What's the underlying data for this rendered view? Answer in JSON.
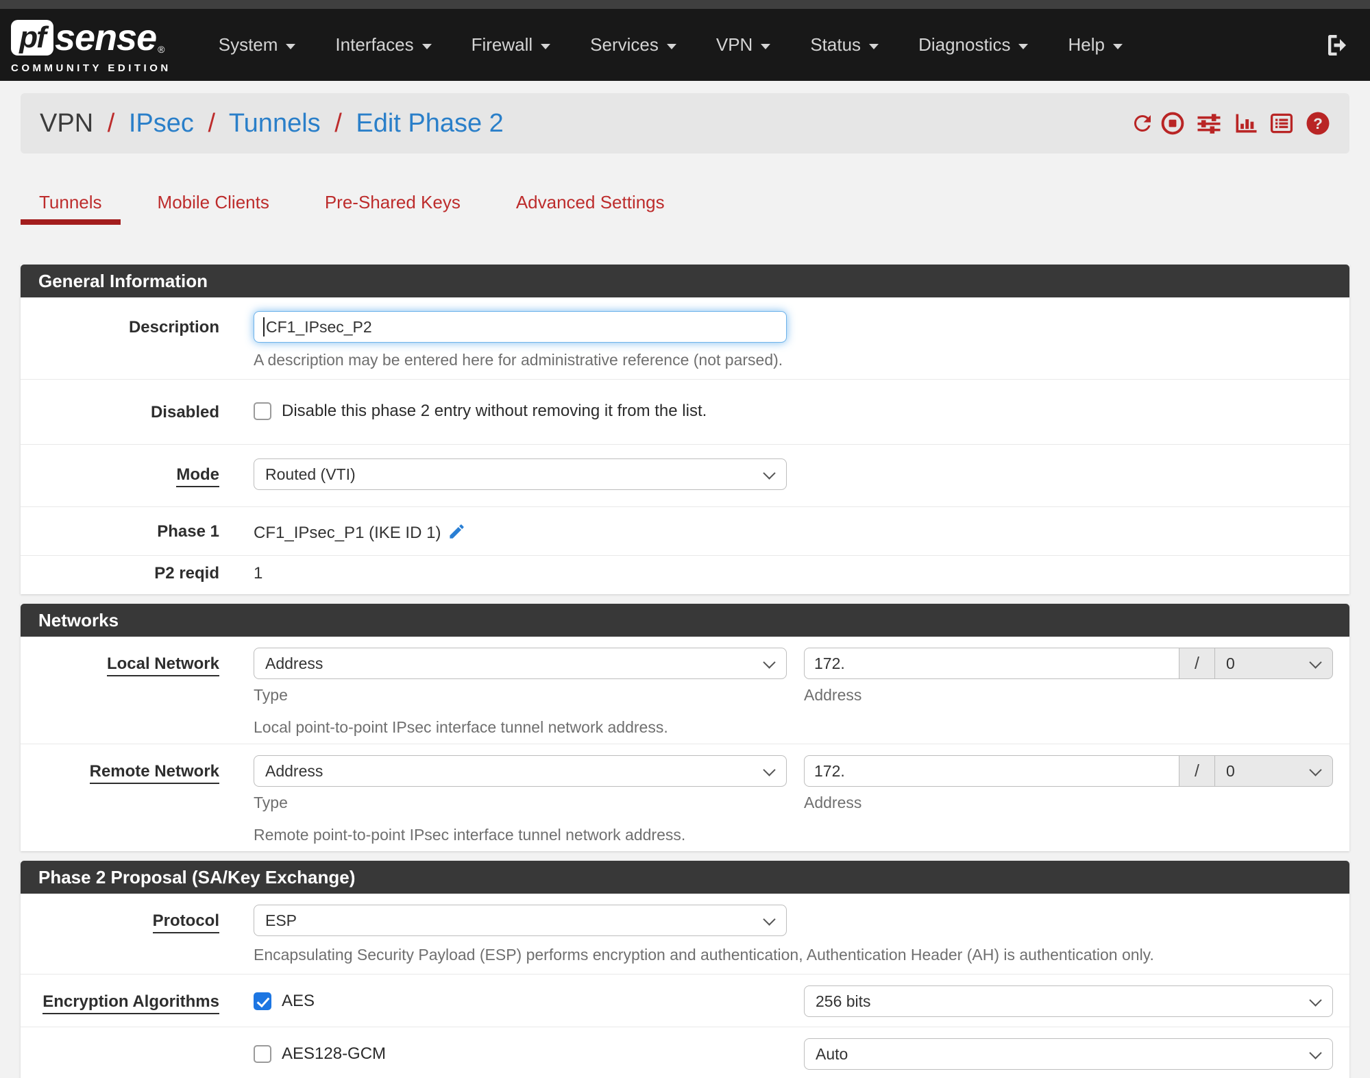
{
  "navbar": {
    "logo": {
      "pf": "pf",
      "sense": "sense",
      "reg": "®",
      "subtitle": "COMMUNITY EDITION"
    },
    "items": [
      "System",
      "Interfaces",
      "Firewall",
      "Services",
      "VPN",
      "Status",
      "Diagnostics",
      "Help"
    ],
    "logout_icon": "sign-out-icon"
  },
  "breadcrumb": {
    "current": "VPN",
    "separator": "/",
    "links": [
      "IPsec",
      "Tunnels",
      "Edit Phase 2"
    ]
  },
  "toolbar": {
    "icons": [
      "refresh-icon",
      "stop-icon",
      "sliders-icon",
      "bar-chart-icon",
      "list-icon",
      "help-icon"
    ]
  },
  "tabs": {
    "items": [
      "Tunnels",
      "Mobile Clients",
      "Pre-Shared Keys",
      "Advanced Settings"
    ],
    "active": "Tunnels"
  },
  "general": {
    "title": "General Information",
    "description_label": "Description",
    "description_value": "CF1_IPsec_P2",
    "description_help": "A description may be entered here for administrative reference (not parsed).",
    "disabled_label": "Disabled",
    "disabled_option": "Disable this phase 2 entry without removing it from the list.",
    "disabled_checked": false,
    "mode_label": "Mode",
    "mode_value": "Routed (VTI)",
    "phase1_label": "Phase 1",
    "phase1_value": "CF1_IPsec_P1 (IKE ID 1)",
    "p2reqid_label": "P2 reqid",
    "p2reqid_value": "1"
  },
  "networks": {
    "title": "Networks",
    "rows": [
      {
        "label": "Local Network",
        "type_value": "Address",
        "type_help": "Type",
        "address_value": "172.",
        "slash": "/",
        "prefix_value": "0",
        "address_help": "Address",
        "description": "Local point-to-point IPsec interface tunnel network address."
      },
      {
        "label": "Remote Network",
        "type_value": "Address",
        "type_help": "Type",
        "address_value": "172.",
        "slash": "/",
        "prefix_value": "0",
        "address_help": "Address",
        "description": "Remote point-to-point IPsec interface tunnel network address."
      }
    ]
  },
  "proposal": {
    "title": "Phase 2 Proposal (SA/Key Exchange)",
    "protocol_label": "Protocol",
    "protocol_value": "ESP",
    "protocol_help": "Encapsulating Security Payload (ESP) performs encryption and authentication, Authentication Header (AH) is authentication only.",
    "encryption_label": "Encryption Algorithms",
    "algorithms": [
      {
        "name": "AES",
        "checked": true,
        "key_length": "256 bits"
      },
      {
        "name": "AES128-GCM",
        "checked": false,
        "key_length": "Auto"
      }
    ]
  },
  "colors": {
    "accent_red": "#bd2c2c",
    "link_blue": "#2a7fc9",
    "checkbox_blue": "#1d76e2",
    "section_header_bg": "#383838",
    "navbar_bg": "#181818"
  }
}
